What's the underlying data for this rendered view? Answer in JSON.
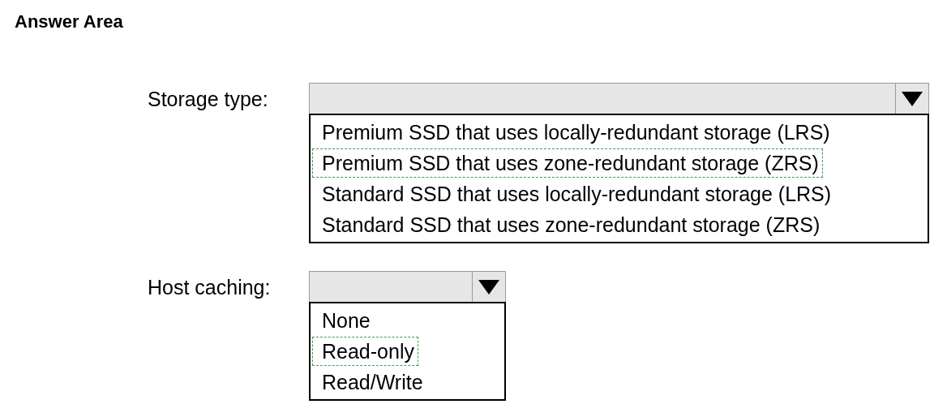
{
  "title": "Answer Area",
  "dropdowns": [
    {
      "label": "Storage type:",
      "options": [
        {
          "text": "Premium SSD that uses locally-redundant storage (LRS)",
          "selected": false
        },
        {
          "text": "Premium SSD that uses zone-redundant storage (ZRS)",
          "selected": true
        },
        {
          "text": "Standard SSD that uses locally-redundant storage (LRS)",
          "selected": false
        },
        {
          "text": "Standard SSD that uses zone-redundant storage (ZRS)",
          "selected": false
        }
      ]
    },
    {
      "label": "Host caching:",
      "options": [
        {
          "text": "None",
          "selected": false
        },
        {
          "text": "Read-only",
          "selected": true
        },
        {
          "text": "Read/Write",
          "selected": false
        }
      ]
    }
  ]
}
